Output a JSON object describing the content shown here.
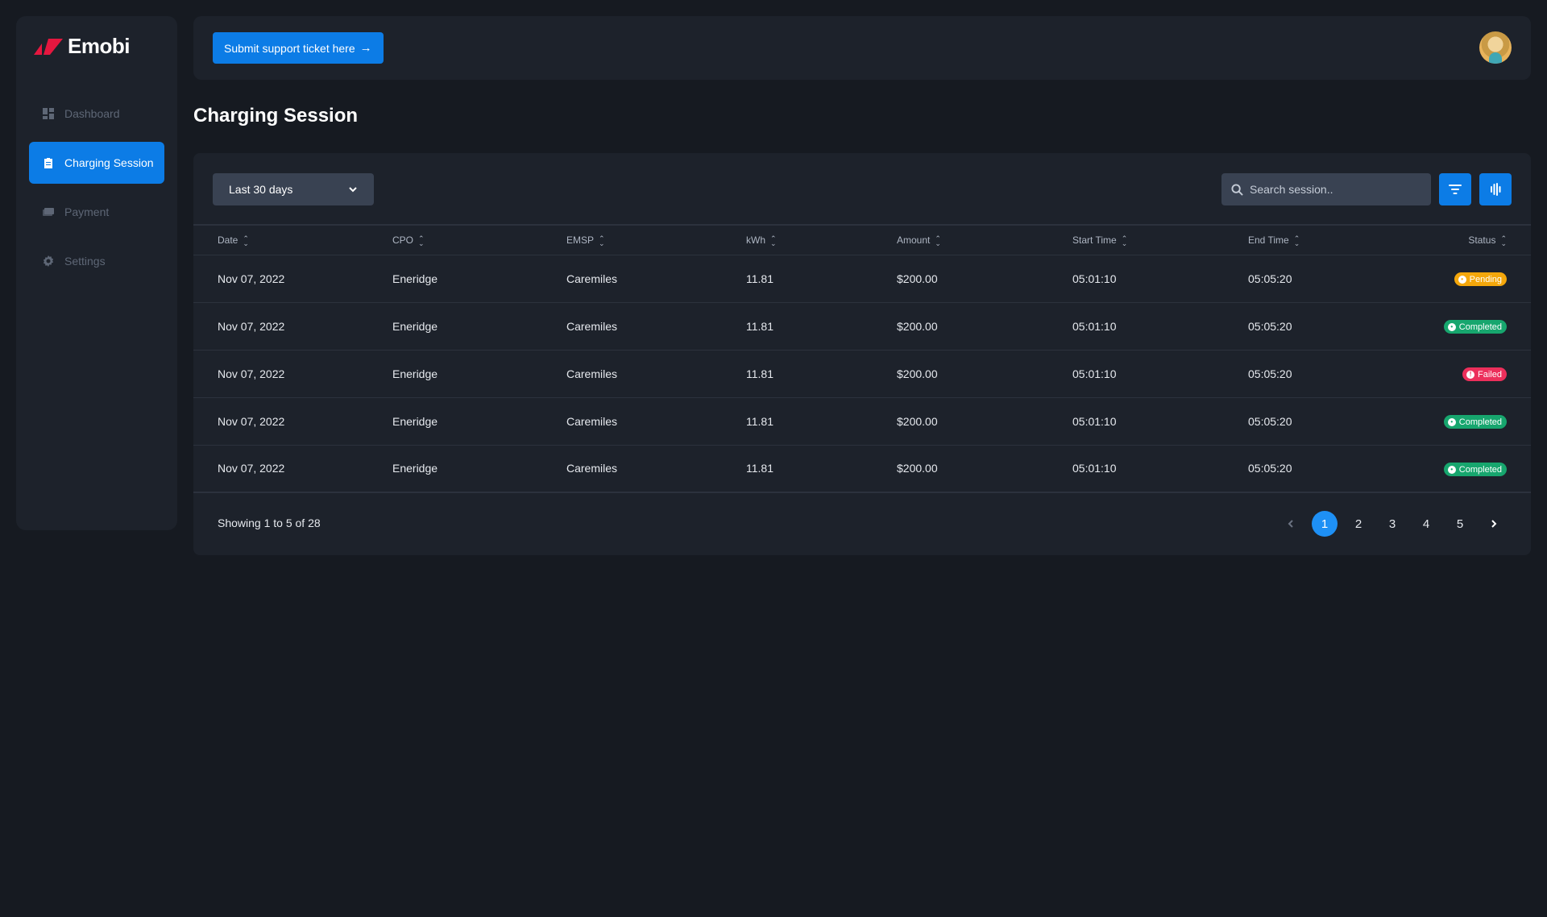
{
  "app": {
    "brand_name": "Emobi",
    "brand_color": "#e5173f",
    "accent": "#0c7ce6"
  },
  "sidebar": {
    "items": [
      {
        "label": "Dashboard",
        "icon": "dashboard-icon",
        "active": false
      },
      {
        "label": "Charging Session",
        "icon": "clipboard-icon",
        "active": true
      },
      {
        "label": "Payment",
        "icon": "money-icon",
        "active": false
      },
      {
        "label": "Settings",
        "icon": "gear-icon",
        "active": false
      }
    ]
  },
  "topbar": {
    "support_label": "Submit support ticket here"
  },
  "page": {
    "title": "Charging Session"
  },
  "toolbar": {
    "range_value": "Last 30 days",
    "search_placeholder": "Search session.."
  },
  "table": {
    "headers": {
      "date": "Date",
      "cpo": "CPO",
      "emsp": "EMSP",
      "kwh": "kWh",
      "amount": "Amount",
      "start": "Start Time",
      "end": "End Time",
      "status": "Status"
    },
    "rows": [
      {
        "date": "Nov 07, 2022",
        "cpo": "Eneridge",
        "emsp": "Caremiles",
        "kwh": "11.81",
        "amount": "$200.00",
        "start": "05:01:10",
        "end": "05:05:20",
        "status": "Pending"
      },
      {
        "date": "Nov 07, 2022",
        "cpo": "Eneridge",
        "emsp": "Caremiles",
        "kwh": "11.81",
        "amount": "$200.00",
        "start": "05:01:10",
        "end": "05:05:20",
        "status": "Completed"
      },
      {
        "date": "Nov 07, 2022",
        "cpo": "Eneridge",
        "emsp": "Caremiles",
        "kwh": "11.81",
        "amount": "$200.00",
        "start": "05:01:10",
        "end": "05:05:20",
        "status": "Failed"
      },
      {
        "date": "Nov 07, 2022",
        "cpo": "Eneridge",
        "emsp": "Caremiles",
        "kwh": "11.81",
        "amount": "$200.00",
        "start": "05:01:10",
        "end": "05:05:20",
        "status": "Completed"
      },
      {
        "date": "Nov 07, 2022",
        "cpo": "Eneridge",
        "emsp": "Caremiles",
        "kwh": "11.81",
        "amount": "$200.00",
        "start": "05:01:10",
        "end": "05:05:20",
        "status": "Completed"
      }
    ]
  },
  "status_colors": {
    "Pending": "#f4a70b",
    "Completed": "#17a66e",
    "Failed": "#ec2f5b"
  },
  "footer": {
    "showing_text": "Showing 1 to 5 of 28",
    "pages": [
      "1",
      "2",
      "3",
      "4",
      "5"
    ],
    "current_page": "1"
  }
}
